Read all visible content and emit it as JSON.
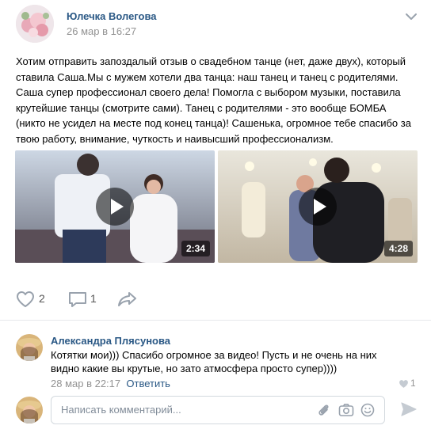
{
  "post": {
    "author": "Юлечка Волегова",
    "date": "26 мар в 16:27",
    "text": "Хотим отправить запоздалый отзыв о свадебном танце (нет, даже двух), который ставила Саша.Мы с мужем хотели два танца: наш танец и танец с родителями. Саша супер профессионал своего дела! Помогла с выбором музыки, поставила крутейшие танцы (смотрите сами). Танец с родителями - это вообще БОМБА (никто не усидел на месте под конец танца)! Сашенька, огромное тебе спасибо за твою работу, внимание, чуткость и наивысший профессионализм.",
    "videos": [
      {
        "duration": "2:34"
      },
      {
        "duration": "4:28"
      }
    ],
    "likes": "2",
    "comments_count": "1"
  },
  "comment": {
    "author": "Александра Плясунова",
    "text": "Котятки мои))) Спасибо огромное за видео! Пусть и не очень на них видно какие вы крутые, но зато атмосфера просто супер))))",
    "date": "28 мар в 22:17",
    "reply": "Ответить",
    "likes": "1"
  },
  "composer": {
    "placeholder": "Написать комментарий..."
  },
  "icons": {
    "expand": "chevron-down-icon",
    "like": "heart-icon",
    "comment": "speech-bubble-icon",
    "share": "share-arrow-icon",
    "attach": "paperclip-icon",
    "camera": "camera-icon",
    "emoji": "smiley-icon",
    "send": "send-icon"
  },
  "colors": {
    "link": "#2a5885",
    "meta": "#939393",
    "icon": "#99a2ad"
  }
}
